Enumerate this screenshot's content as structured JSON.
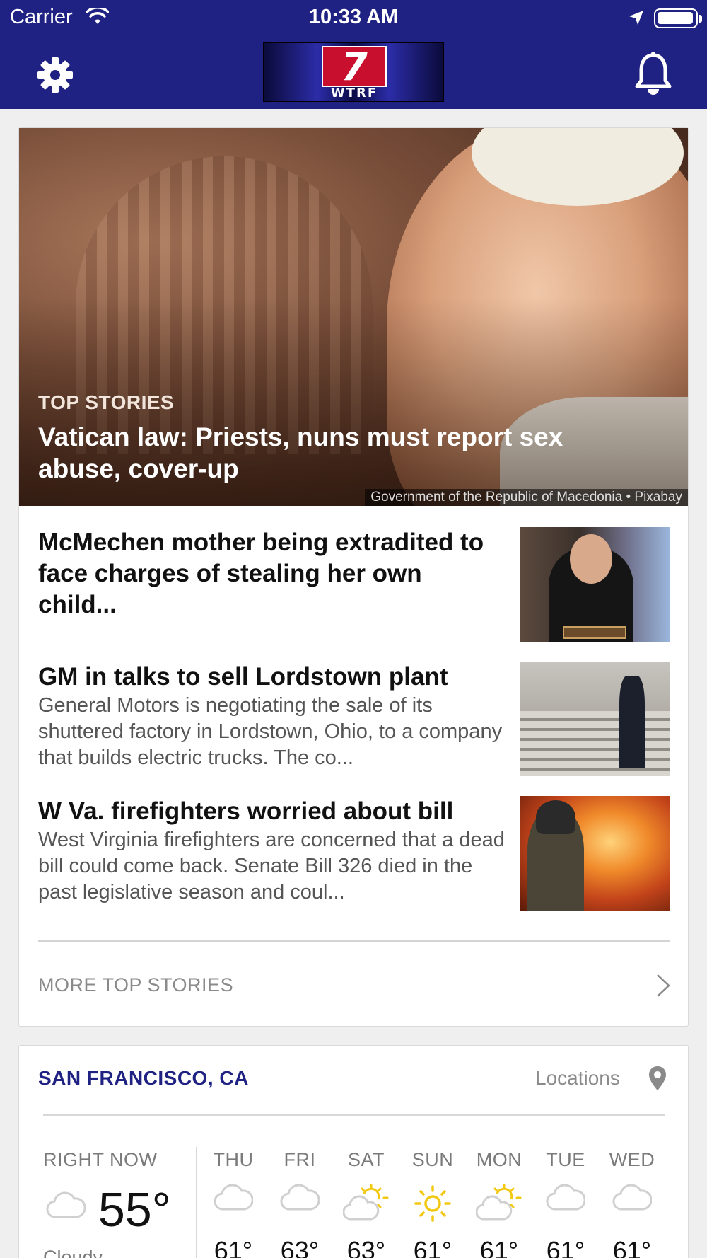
{
  "status_bar": {
    "carrier": "Carrier",
    "time": "10:33 AM"
  },
  "nav": {
    "logo_number": "7",
    "logo_call_sign": "WTRF"
  },
  "top_stories": {
    "hero": {
      "kicker": "TOP STORIES",
      "headline": "Vatican law: Priests, nuns must report sex abuse, cover-up",
      "credit": "Government of the Republic of Macedonia • Pixabay"
    },
    "items": [
      {
        "title": "McMechen mother being extradited to face charges of stealing her own child...",
        "desc": ""
      },
      {
        "title": "GM in talks to sell Lordstown plant",
        "desc": "General Motors is negotiating the sale of its shuttered factory in Lordstown, Ohio, to a company that builds electric trucks. The co..."
      },
      {
        "title": "W Va. firefighters worried about bill",
        "desc": "West Virginia firefighters are concerned that a dead bill could come back. Senate Bill 326 died in the past legislative season and coul..."
      }
    ],
    "more_label": "MORE TOP STORIES"
  },
  "weather": {
    "city": "SAN FRANCISCO, CA",
    "locations_label": "Locations",
    "right_now": {
      "label": "RIGHT NOW",
      "temp": "55°",
      "condition": "Cloudy",
      "icon": "cloud-icon"
    },
    "days": [
      {
        "name": "THU",
        "temp": "61°",
        "icon": "cloud"
      },
      {
        "name": "FRI",
        "temp": "63°",
        "icon": "cloud"
      },
      {
        "name": "SAT",
        "temp": "63°",
        "icon": "partly-sunny"
      },
      {
        "name": "SUN",
        "temp": "61°",
        "icon": "sun"
      },
      {
        "name": "MON",
        "temp": "61°",
        "icon": "partly-sunny"
      },
      {
        "name": "TUE",
        "temp": "61°",
        "icon": "cloud"
      },
      {
        "name": "WED",
        "temp": "61°",
        "icon": "cloud"
      }
    ]
  },
  "colors": {
    "nav_bg": "#1f2283",
    "accent": "#1f2283",
    "sun": "#f2c811"
  }
}
